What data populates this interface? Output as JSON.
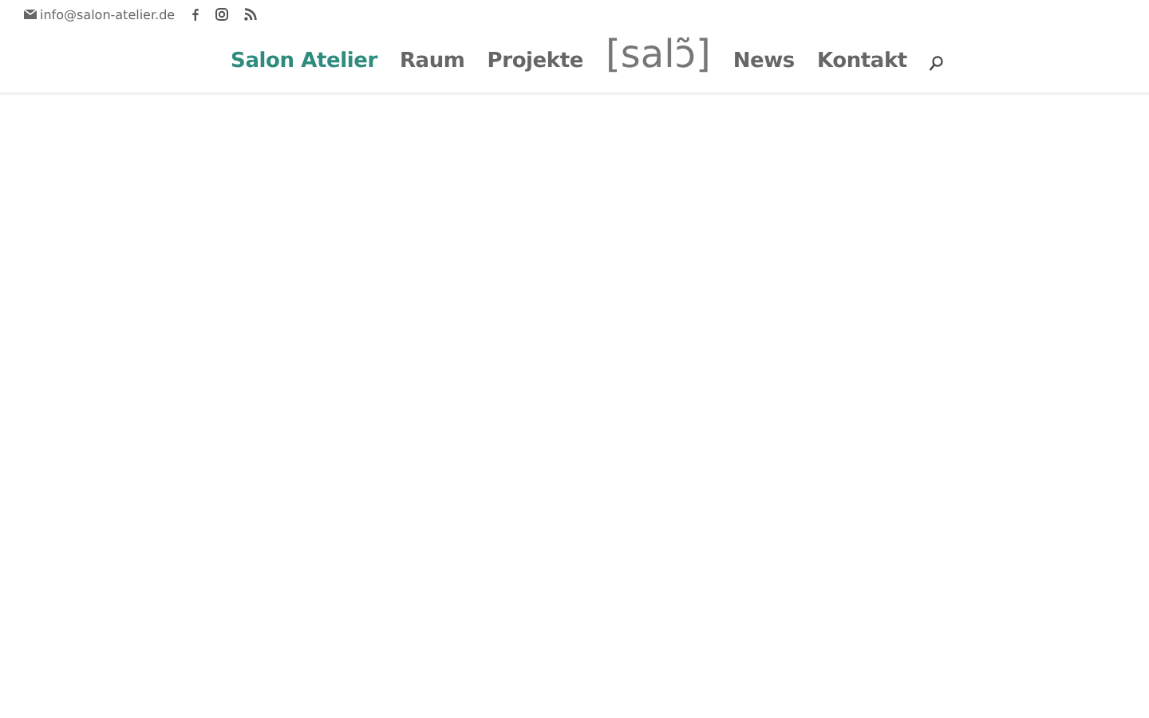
{
  "top_bar": {
    "email": "info@salon-atelier.de"
  },
  "nav": {
    "items_left": [
      {
        "label": "Salon Atelier",
        "selected": true
      },
      {
        "label": "Raum",
        "selected": false
      },
      {
        "label": "Projekte",
        "selected": false
      }
    ],
    "logo": "[salɔ̃]",
    "items_right": [
      {
        "label": "News",
        "selected": false
      },
      {
        "label": "Kontakt",
        "selected": false
      }
    ]
  }
}
